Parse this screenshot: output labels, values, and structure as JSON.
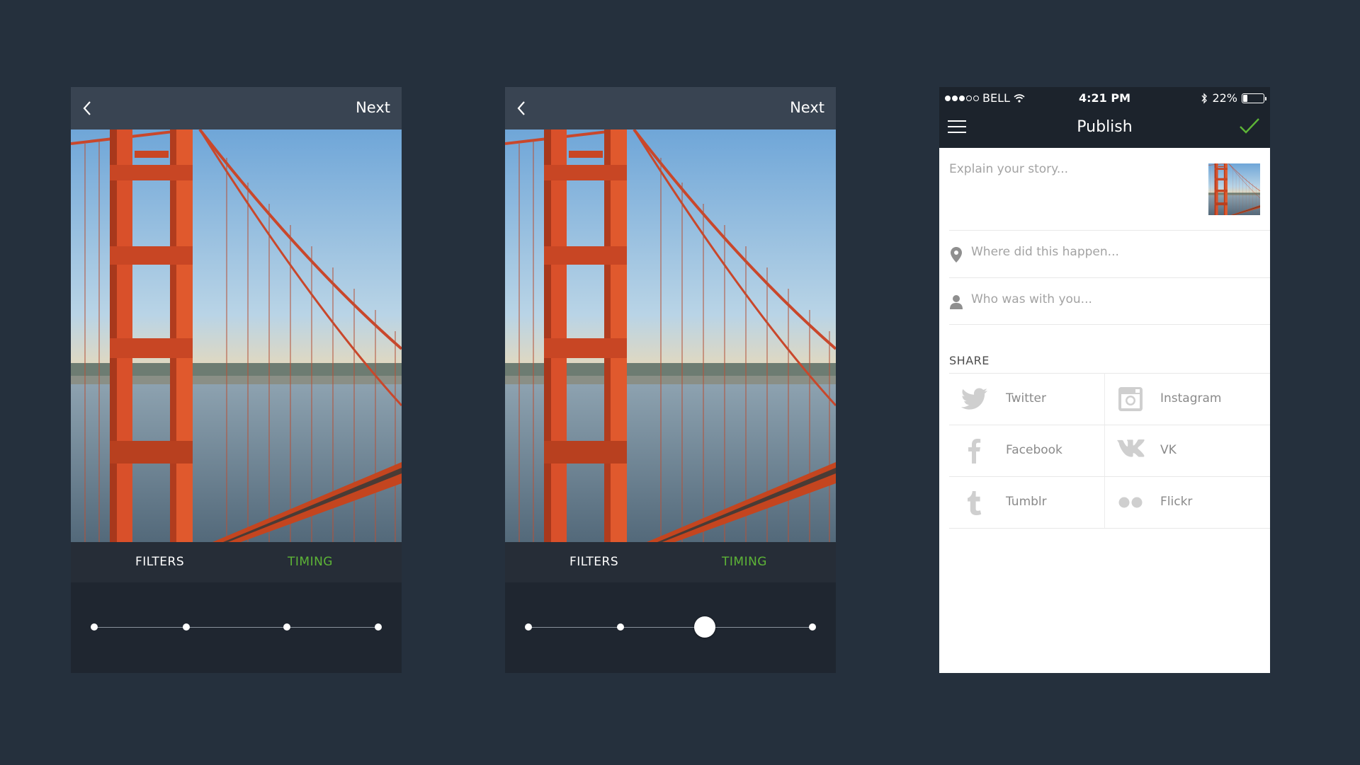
{
  "editor_screens": [
    {
      "header": {
        "next_label": "Next"
      },
      "tabs": {
        "filters_label": "FILTERS",
        "timing_label": "TIMING"
      },
      "slider": {
        "stops": 4,
        "selected_stop": null
      }
    },
    {
      "header": {
        "next_label": "Next"
      },
      "tabs": {
        "filters_label": "FILTERS",
        "timing_label": "TIMING"
      },
      "slider": {
        "stops": 4,
        "selected_position": 0.62
      }
    }
  ],
  "publish": {
    "status_bar": {
      "carrier": "BELL",
      "signal_bars_filled": 3,
      "signal_bars_total": 5,
      "time": "4:21 PM",
      "battery_text": "22%",
      "battery_level": 0.22
    },
    "nav": {
      "title": "Publish"
    },
    "story": {
      "placeholder": "Explain your story..."
    },
    "location": {
      "placeholder": "Where did this happen..."
    },
    "people": {
      "placeholder": "Who was with you..."
    },
    "share": {
      "label": "SHARE",
      "services": [
        {
          "label": "Twitter",
          "icon": "twitter-icon"
        },
        {
          "label": "Instagram",
          "icon": "instagram-icon"
        },
        {
          "label": "Facebook",
          "icon": "facebook-icon"
        },
        {
          "label": "VK",
          "icon": "vk-icon"
        },
        {
          "label": "Tumblr",
          "icon": "tumblr-icon"
        },
        {
          "label": "Flickr",
          "icon": "flickr-icon"
        }
      ]
    }
  },
  "colors": {
    "background": "#25303d",
    "accent_green": "#5db437",
    "editor_header": "#394452",
    "editor_panel": "#1f2630",
    "publish_header": "#1c232c"
  }
}
